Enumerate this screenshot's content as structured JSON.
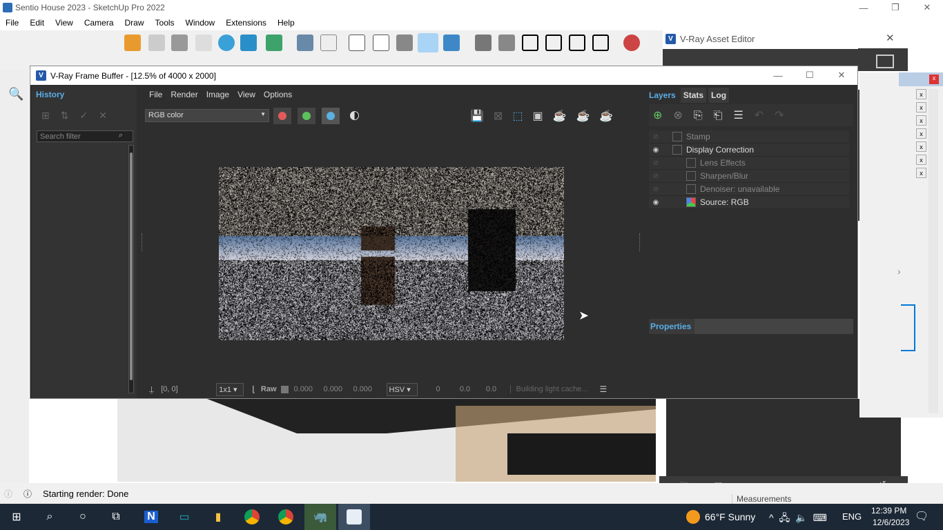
{
  "sketchup": {
    "title": "Sentio House 2023 - SketchUp Pro 2022",
    "menu": [
      "File",
      "Edit",
      "View",
      "Camera",
      "Draw",
      "Tools",
      "Window",
      "Extensions",
      "Help"
    ],
    "status": "Starting render: Done",
    "measurements_label": "Measurements"
  },
  "vfb": {
    "title": "V-Ray Frame Buffer - [12.5% of 4000 x 2000]",
    "history_tab": "History",
    "search_placeholder": "Search filter",
    "menu": [
      "File",
      "Render",
      "Image",
      "View",
      "Options"
    ],
    "channel": "RGB color",
    "channel_colors": [
      "#e05a5a",
      "#5cc15c",
      "#5ab0e0"
    ],
    "bottom": {
      "coords": "[0, 0]",
      "zoom": "1x1",
      "raw_label": "Raw",
      "rgb": [
        "0.000",
        "0.000",
        "0.000"
      ],
      "color_mode": "HSV",
      "hsv": [
        "0",
        "0.0",
        "0.0"
      ],
      "progress_text": "Building light cache..."
    },
    "right_tabs": [
      "Layers",
      "Stats",
      "Log"
    ],
    "layers": [
      {
        "name": "Stamp",
        "visible": false,
        "indent": 0
      },
      {
        "name": "Display Correction",
        "visible": true,
        "indent": 0
      },
      {
        "name": "Lens Effects",
        "visible": false,
        "indent": 1
      },
      {
        "name": "Sharpen/Blur",
        "visible": false,
        "indent": 1
      },
      {
        "name": "Denoiser: unavailable",
        "visible": false,
        "indent": 1
      },
      {
        "name": "Source: RGB",
        "visible": true,
        "indent": 1
      }
    ],
    "properties_label": "Properties"
  },
  "asset_editor": {
    "title": "V-Ray Asset Editor"
  },
  "taskbar": {
    "weather": "66°F  Sunny",
    "lang": "ENG",
    "time": "12:39 PM",
    "date": "12/6/2023"
  }
}
